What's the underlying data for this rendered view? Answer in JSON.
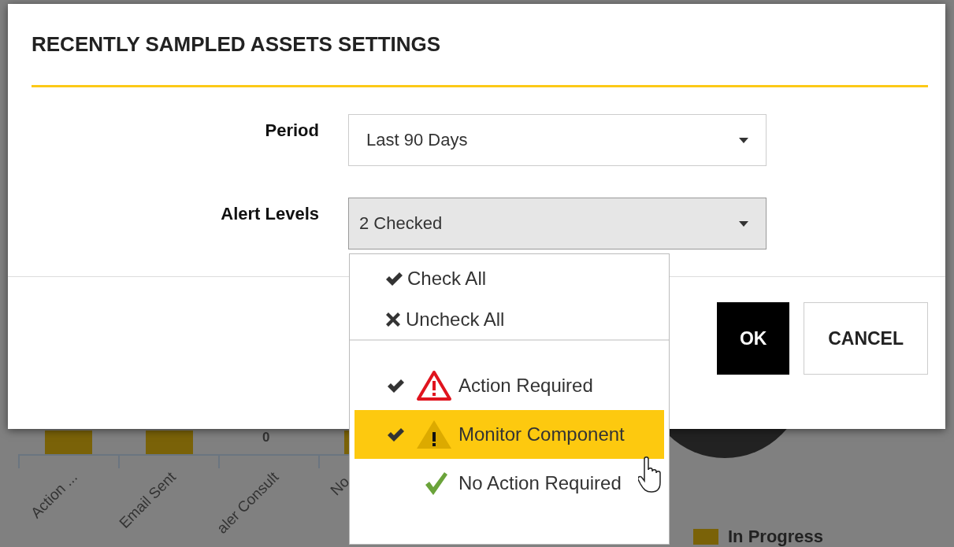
{
  "background_chart": {
    "value_labels": [
      {
        "text": "0"
      }
    ],
    "categories": [
      "Action ...",
      "Email Sent",
      "aler Consult",
      "No"
    ],
    "legend": [
      {
        "label": "In Progress",
        "color": "#7a6208"
      }
    ]
  },
  "dialog": {
    "title": "RECENTLY SAMPLED ASSETS SETTINGS",
    "fields": [
      {
        "label": "Period",
        "value": "Last 90 Days",
        "open": false
      },
      {
        "label": "Alert Levels",
        "value": "2 Checked",
        "open": true
      }
    ],
    "buttons": [
      {
        "label": "OK",
        "kind": "primary"
      },
      {
        "label": "CANCEL",
        "kind": "secondary"
      }
    ]
  },
  "dropdown": {
    "actions": [
      {
        "label": "Check All",
        "kind": "check"
      },
      {
        "label": "Uncheck All",
        "kind": "uncheck"
      }
    ],
    "options": [
      {
        "label": "Action Required",
        "kind": "danger",
        "checked": true,
        "selected": false
      },
      {
        "label": "Monitor Component",
        "kind": "warning",
        "checked": true,
        "selected": true
      },
      {
        "label": "No Action Required",
        "kind": "ok",
        "checked": false,
        "selected": false
      }
    ]
  }
}
